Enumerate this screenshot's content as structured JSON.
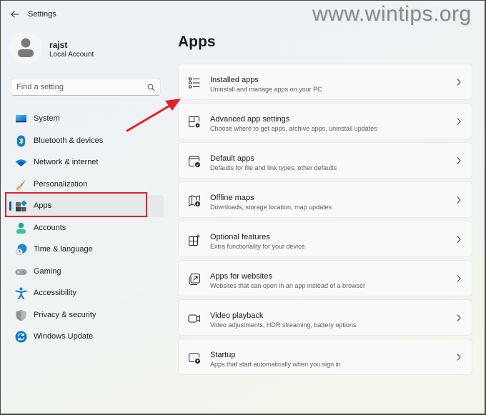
{
  "window": {
    "title": "Settings",
    "watermark": "www.wintips.org"
  },
  "profile": {
    "name": "rajst",
    "account_type": "Local Account"
  },
  "search": {
    "placeholder": "Find a setting",
    "value": ""
  },
  "sidebar": {
    "items": [
      {
        "label": "System",
        "icon": "system-icon",
        "active": false
      },
      {
        "label": "Bluetooth & devices",
        "icon": "bluetooth-icon",
        "active": false
      },
      {
        "label": "Network & internet",
        "icon": "wifi-icon",
        "active": false
      },
      {
        "label": "Personalization",
        "icon": "brush-icon",
        "active": false
      },
      {
        "label": "Apps",
        "icon": "apps-icon",
        "active": true
      },
      {
        "label": "Accounts",
        "icon": "accounts-icon",
        "active": false
      },
      {
        "label": "Time & language",
        "icon": "time-language-icon",
        "active": false
      },
      {
        "label": "Gaming",
        "icon": "gamepad-icon",
        "active": false
      },
      {
        "label": "Accessibility",
        "icon": "accessibility-icon",
        "active": false
      },
      {
        "label": "Privacy & security",
        "icon": "shield-icon",
        "active": false
      },
      {
        "label": "Windows Update",
        "icon": "update-icon",
        "active": false
      }
    ]
  },
  "main": {
    "title": "Apps",
    "cards": [
      {
        "title": "Installed apps",
        "description": "Uninstall and manage apps on your PC",
        "icon": "list-icon"
      },
      {
        "title": "Advanced app settings",
        "description": "Choose where to get apps, archive apps, uninstall updates",
        "icon": "app-settings-icon"
      },
      {
        "title": "Default apps",
        "description": "Defaults for file and link types, other defaults",
        "icon": "default-apps-icon"
      },
      {
        "title": "Offline maps",
        "description": "Downloads, storage location, map updates",
        "icon": "map-icon"
      },
      {
        "title": "Optional features",
        "description": "Extra functionality for your device",
        "icon": "optional-features-icon"
      },
      {
        "title": "Apps for websites",
        "description": "Websites that can open in an app instead of a browser",
        "icon": "open-external-icon"
      },
      {
        "title": "Video playback",
        "description": "Video adjustments, HDR streaming, battery options",
        "icon": "video-camera-icon"
      },
      {
        "title": "Startup",
        "description": "Apps that start automatically when you sign in",
        "icon": "startup-icon"
      }
    ]
  },
  "colors": {
    "accent": "#005fb8",
    "annotation_red": "#e3202a"
  }
}
